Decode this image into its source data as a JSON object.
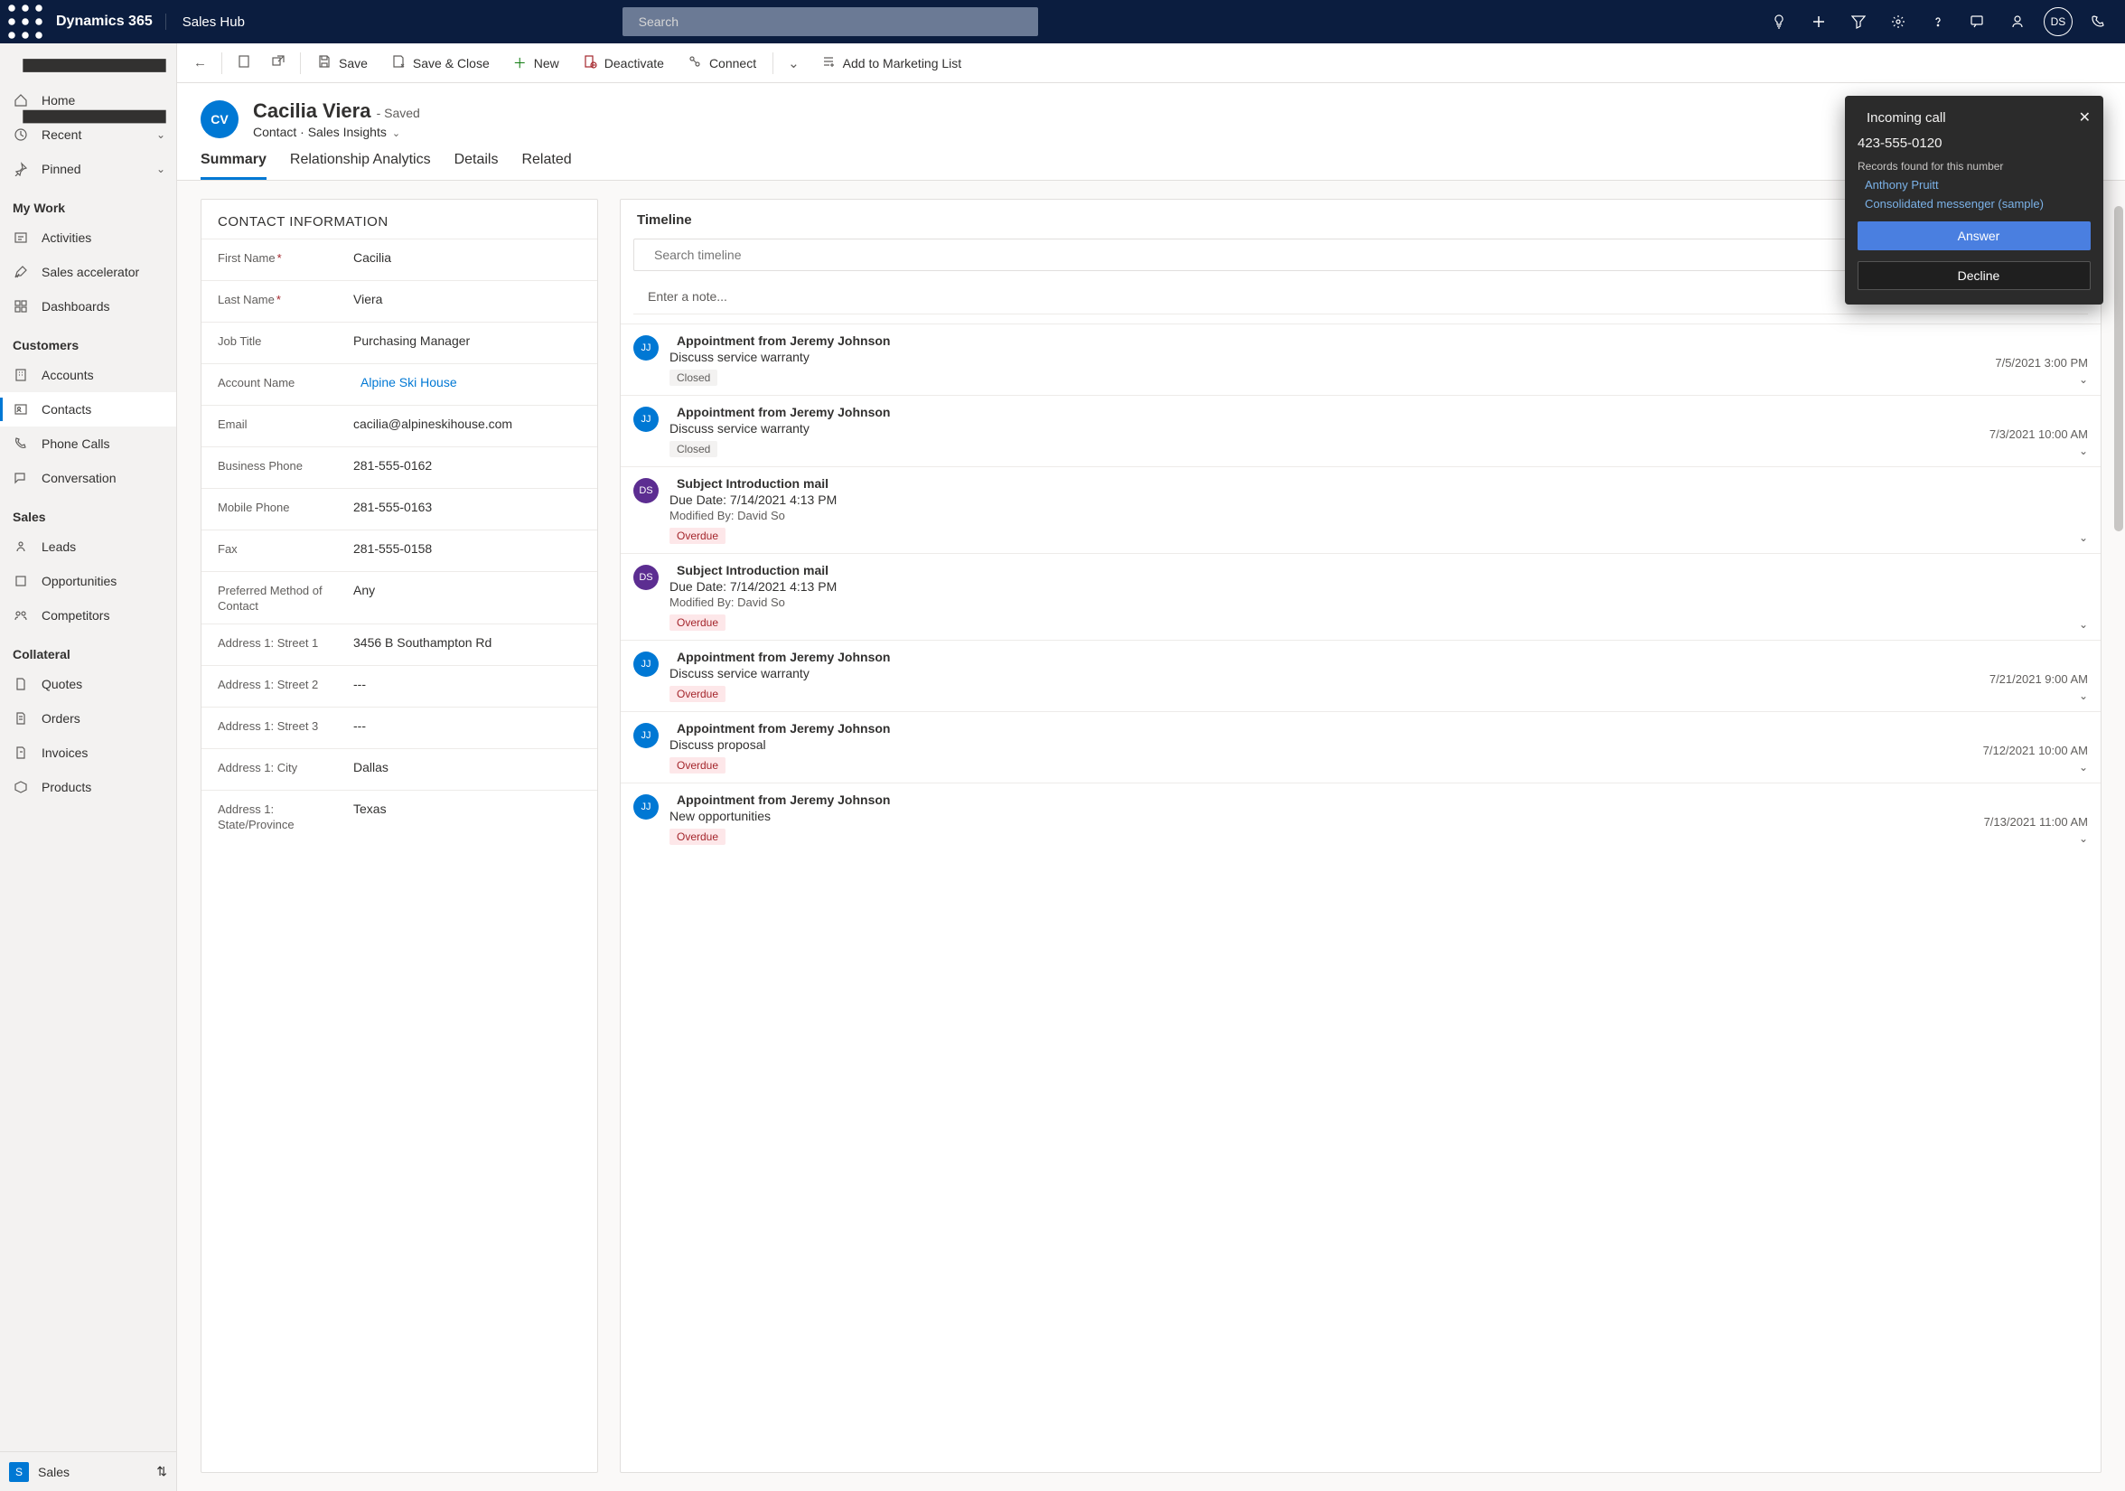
{
  "topbar": {
    "brand": "Dynamics 365",
    "appname": "Sales Hub",
    "search_placeholder": "Search",
    "avatar_initials": "DS"
  },
  "sidebar": {
    "home": "Home",
    "recent": "Recent",
    "pinned": "Pinned",
    "groups": {
      "mywork": "My Work",
      "customers": "Customers",
      "sales": "Sales",
      "collateral": "Collateral"
    },
    "items": {
      "activities": "Activities",
      "salesaccel": "Sales accelerator",
      "dashboards": "Dashboards",
      "accounts": "Accounts",
      "contacts": "Contacts",
      "phonecalls": "Phone Calls",
      "conversation": "Conversation",
      "leads": "Leads",
      "opportunities": "Opportunities",
      "competitors": "Competitors",
      "quotes": "Quotes",
      "orders": "Orders",
      "invoices": "Invoices",
      "products": "Products"
    },
    "area": "Sales",
    "area_badge": "S"
  },
  "commands": {
    "save": "Save",
    "saveclose": "Save & Close",
    "new": "New",
    "deactivate": "Deactivate",
    "connect": "Connect",
    "addmarketing": "Add to Marketing List"
  },
  "record": {
    "initials": "CV",
    "name": "Cacilia Viera",
    "saved_suffix": "- Saved",
    "entity": "Contact",
    "form": "Sales Insights"
  },
  "tabs": {
    "summary": "Summary",
    "relanalytics": "Relationship Analytics",
    "details": "Details",
    "related": "Related"
  },
  "contactinfo": {
    "title": "CONTACT INFORMATION",
    "labels": {
      "firstname": "First Name",
      "lastname": "Last Name",
      "jobtitle": "Job Title",
      "accountname": "Account Name",
      "email": "Email",
      "busphone": "Business Phone",
      "mobphone": "Mobile Phone",
      "fax": "Fax",
      "prefcontact": "Preferred Method of Contact",
      "street1": "Address 1: Street 1",
      "street2": "Address 1: Street 2",
      "street3": "Address 1: Street 3",
      "city": "Address 1: City",
      "state": "Address 1: State/Province"
    },
    "values": {
      "firstname": "Cacilia",
      "lastname": "Viera",
      "jobtitle": "Purchasing Manager",
      "accountname": "Alpine Ski House",
      "email": "cacilia@alpineskihouse.com",
      "busphone": "281-555-0162",
      "mobphone": "281-555-0163",
      "fax": "281-555-0158",
      "prefcontact": "Any",
      "street1": "3456 B Southampton Rd",
      "street2": "---",
      "street3": "---",
      "city": "Dallas",
      "state": "Texas"
    }
  },
  "timeline": {
    "title": "Timeline",
    "search_placeholder": "Search timeline",
    "note_placeholder": "Enter a note...",
    "items": [
      {
        "avatar": "JJ",
        "avclass": "jj",
        "type": "calendar",
        "title": "Appointment from Jeremy Johnson",
        "desc": "Discuss service warranty",
        "status": "Closed",
        "statusClass": "",
        "ts": "7/5/2021 3:00 PM"
      },
      {
        "avatar": "JJ",
        "avclass": "jj",
        "type": "calendar",
        "title": "Appointment from Jeremy Johnson",
        "desc": "Discuss service warranty",
        "status": "Closed",
        "statusClass": "",
        "ts": "7/3/2021 10:00 AM"
      },
      {
        "avatar": "DS",
        "avclass": "ds",
        "type": "mail",
        "title": "Subject Introduction mail",
        "desc": "Due Date: 7/14/2021 4:13 PM",
        "meta": "Modified By: David So",
        "status": "Overdue",
        "statusClass": "overdue",
        "ts": ""
      },
      {
        "avatar": "DS",
        "avclass": "ds",
        "type": "mail",
        "title": "Subject Introduction mail",
        "desc": "Due Date: 7/14/2021 4:13 PM",
        "meta": "Modified By: David So",
        "status": "Overdue",
        "statusClass": "overdue",
        "ts": ""
      },
      {
        "avatar": "JJ",
        "avclass": "jj",
        "type": "calendar",
        "title": "Appointment from Jeremy Johnson",
        "desc": "Discuss service warranty",
        "status": "Overdue",
        "statusClass": "overdue",
        "ts": "7/21/2021 9:00 AM"
      },
      {
        "avatar": "JJ",
        "avclass": "jj",
        "type": "calendar",
        "title": "Appointment from Jeremy Johnson",
        "desc": "Discuss proposal",
        "status": "Overdue",
        "statusClass": "overdue",
        "ts": "7/12/2021 10:00 AM"
      },
      {
        "avatar": "JJ",
        "avclass": "jj",
        "type": "calendar",
        "title": "Appointment from Jeremy Johnson",
        "desc": "New opportunities",
        "status": "Overdue",
        "statusClass": "overdue",
        "ts": "7/13/2021 11:00 AM"
      }
    ]
  },
  "call": {
    "header": "Incoming call",
    "number": "423-555-0120",
    "found": "Records found for this number",
    "person": "Anthony Pruitt",
    "account": "Consolidated messenger (sample)",
    "answer": "Answer",
    "decline": "Decline"
  }
}
